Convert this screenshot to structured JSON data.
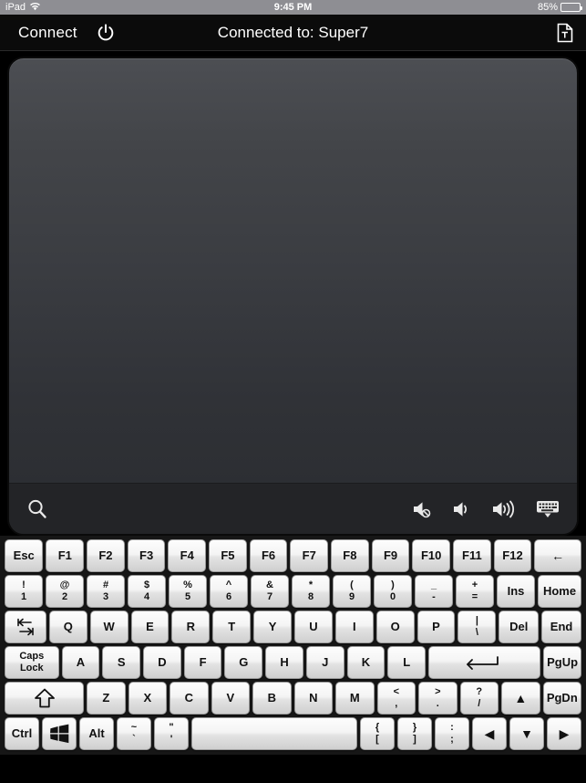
{
  "status_bar": {
    "carrier": "iPad",
    "wifi_icon": "wifi-icon",
    "time": "9:45 PM",
    "battery_percent": "85%",
    "battery_level": 85,
    "battery_icon": "battery-icon"
  },
  "nav_bar": {
    "connect_label": "Connect",
    "power_icon": "power-icon",
    "title": "Connected to: Super7",
    "document_icon": "text-document-icon"
  },
  "trackpad": {
    "search_icon": "search-icon",
    "controls": [
      {
        "name": "mute-icon",
        "label": "Mute"
      },
      {
        "name": "volume-down-icon",
        "label": "Volume Down"
      },
      {
        "name": "volume-up-icon",
        "label": "Volume Up"
      },
      {
        "name": "hide-keyboard-icon",
        "label": "Hide Keyboard"
      }
    ]
  },
  "keyboard": {
    "rows": [
      {
        "name": "function-row",
        "keys": [
          {
            "name": "key-esc",
            "label": "Esc"
          },
          {
            "name": "key-f1",
            "label": "F1"
          },
          {
            "name": "key-f2",
            "label": "F2"
          },
          {
            "name": "key-f3",
            "label": "F3"
          },
          {
            "name": "key-f4",
            "label": "F4"
          },
          {
            "name": "key-f5",
            "label": "F5"
          },
          {
            "name": "key-f6",
            "label": "F6"
          },
          {
            "name": "key-f7",
            "label": "F7"
          },
          {
            "name": "key-f8",
            "label": "F8"
          },
          {
            "name": "key-f9",
            "label": "F9"
          },
          {
            "name": "key-f10",
            "label": "F10"
          },
          {
            "name": "key-f11",
            "label": "F11"
          },
          {
            "name": "key-f12",
            "label": "F12"
          },
          {
            "name": "key-backspace",
            "label": "←",
            "glyph": true
          }
        ]
      },
      {
        "name": "number-row",
        "keys": [
          {
            "name": "key-1",
            "top": "!",
            "label": "1"
          },
          {
            "name": "key-2",
            "top": "@",
            "label": "2"
          },
          {
            "name": "key-3",
            "top": "#",
            "label": "3"
          },
          {
            "name": "key-4",
            "top": "$",
            "label": "4"
          },
          {
            "name": "key-5",
            "top": "%",
            "label": "5"
          },
          {
            "name": "key-6",
            "top": "^",
            "label": "6"
          },
          {
            "name": "key-7",
            "top": "&",
            "label": "7"
          },
          {
            "name": "key-8",
            "top": "*",
            "label": "8"
          },
          {
            "name": "key-9",
            "top": "(",
            "label": "9"
          },
          {
            "name": "key-0",
            "top": ")",
            "label": "0"
          },
          {
            "name": "key-minus",
            "top": "_",
            "label": "-"
          },
          {
            "name": "key-equals",
            "top": "+",
            "label": "="
          },
          {
            "name": "key-ins",
            "label": "Ins"
          },
          {
            "name": "key-home",
            "label": "Home"
          }
        ]
      },
      {
        "name": "top-letter-row",
        "keys": [
          {
            "name": "key-tab",
            "label": "tab-icon",
            "icon": "tab"
          },
          {
            "name": "key-q",
            "label": "Q"
          },
          {
            "name": "key-w",
            "label": "W"
          },
          {
            "name": "key-e",
            "label": "E"
          },
          {
            "name": "key-r",
            "label": "R"
          },
          {
            "name": "key-t",
            "label": "T"
          },
          {
            "name": "key-y",
            "label": "Y"
          },
          {
            "name": "key-u",
            "label": "U"
          },
          {
            "name": "key-i",
            "label": "I"
          },
          {
            "name": "key-o",
            "label": "O"
          },
          {
            "name": "key-p",
            "label": "P"
          },
          {
            "name": "key-backslash",
            "top": "|",
            "label": "\\"
          },
          {
            "name": "key-del",
            "label": "Del"
          },
          {
            "name": "key-end",
            "label": "End"
          }
        ]
      },
      {
        "name": "home-row",
        "keys": [
          {
            "name": "key-caps-lock",
            "line1": "Caps",
            "line2": "Lock"
          },
          {
            "name": "key-a",
            "label": "A"
          },
          {
            "name": "key-s",
            "label": "S"
          },
          {
            "name": "key-d",
            "label": "D"
          },
          {
            "name": "key-f",
            "label": "F"
          },
          {
            "name": "key-g",
            "label": "G"
          },
          {
            "name": "key-h",
            "label": "H"
          },
          {
            "name": "key-j",
            "label": "J"
          },
          {
            "name": "key-k",
            "label": "K"
          },
          {
            "name": "key-l",
            "label": "L"
          },
          {
            "name": "key-enter",
            "label": "enter-icon",
            "icon": "enter"
          },
          {
            "name": "key-pgup",
            "label": "PgUp"
          }
        ]
      },
      {
        "name": "bottom-letter-row",
        "keys": [
          {
            "name": "key-shift",
            "label": "shift-icon",
            "icon": "shift"
          },
          {
            "name": "key-z",
            "label": "Z"
          },
          {
            "name": "key-x",
            "label": "X"
          },
          {
            "name": "key-c",
            "label": "C"
          },
          {
            "name": "key-v",
            "label": "V"
          },
          {
            "name": "key-b",
            "label": "B"
          },
          {
            "name": "key-n",
            "label": "N"
          },
          {
            "name": "key-m",
            "label": "M"
          },
          {
            "name": "key-comma",
            "top": "<",
            "label": ","
          },
          {
            "name": "key-period",
            "top": ">",
            "label": "."
          },
          {
            "name": "key-slash",
            "top": "?",
            "label": "/"
          },
          {
            "name": "key-arrow-up",
            "label": "▲",
            "glyph": true
          },
          {
            "name": "key-pgdn",
            "label": "PgDn"
          }
        ]
      },
      {
        "name": "modifier-row",
        "keys": [
          {
            "name": "key-ctrl",
            "label": "Ctrl"
          },
          {
            "name": "key-windows",
            "label": "windows-icon",
            "icon": "windows"
          },
          {
            "name": "key-alt",
            "label": "Alt"
          },
          {
            "name": "key-tilde",
            "top": "~",
            "label": "`"
          },
          {
            "name": "key-quote",
            "top": "\"",
            "label": "'"
          },
          {
            "name": "key-space",
            "label": ""
          },
          {
            "name": "key-bracket-left",
            "top": "{",
            "label": "["
          },
          {
            "name": "key-bracket-right",
            "top": "}",
            "label": "]"
          },
          {
            "name": "key-semicolon",
            "top": ":",
            "label": ";"
          },
          {
            "name": "key-arrow-left",
            "label": "◀",
            "glyph": true
          },
          {
            "name": "key-arrow-down",
            "label": "▼",
            "glyph": true
          },
          {
            "name": "key-arrow-right",
            "label": "▶",
            "glyph": true
          }
        ]
      }
    ]
  },
  "colors": {
    "status_bar_bg": "#8e8e93",
    "nav_bg": "#0b0b0b",
    "keyboard_bg": "#161616",
    "key_face": "#f4f4f4",
    "trackpad_top": "#4c4e53",
    "trackpad_bottom": "#2a2c30"
  }
}
